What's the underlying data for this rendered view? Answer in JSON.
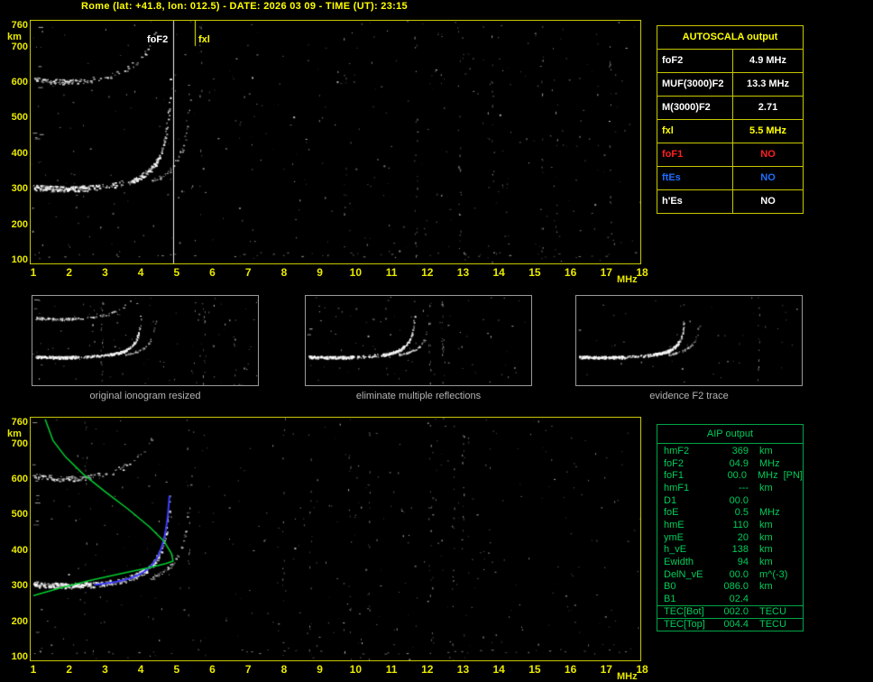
{
  "header": {
    "title": "Rome (lat: +41.8, lon: 012.5) - DATE: 2026 03 09 - TIME (UT): 23:15"
  },
  "top_plot": {
    "y_unit": "km",
    "x_unit": "MHz",
    "y_ticks": [
      760,
      700,
      600,
      500,
      400,
      300,
      200,
      100
    ],
    "x_ticks": [
      1,
      2,
      3,
      4,
      5,
      6,
      7,
      8,
      9,
      10,
      11,
      12,
      13,
      14,
      15,
      16,
      17,
      18
    ],
    "markers": [
      {
        "label": "foF2",
        "mhz": 4.9,
        "color": "#ffffff"
      },
      {
        "label": "fxl",
        "mhz": 5.5,
        "color": "#ffff00"
      }
    ]
  },
  "bottom_plot": {
    "y_unit": "km",
    "x_unit": "MHz",
    "y_ticks": [
      760,
      700,
      600,
      500,
      400,
      300,
      200,
      100
    ],
    "x_ticks": [
      1,
      2,
      3,
      4,
      5,
      6,
      7,
      8,
      9,
      10,
      11,
      12,
      13,
      14,
      15,
      16,
      17,
      18
    ]
  },
  "autoscala_table": {
    "title": "AUTOSCALA output",
    "rows": [
      {
        "label": "foF2",
        "value": "4.9 MHz",
        "color": "#ffffff"
      },
      {
        "label": "MUF(3000)F2",
        "value": "13.3 MHz",
        "color": "#ffffff"
      },
      {
        "label": "M(3000)F2",
        "value": "2.71",
        "color": "#ffffff"
      },
      {
        "label": "fxl",
        "value": "5.5 MHz",
        "color": "#ffff00"
      },
      {
        "label": "foF1",
        "value": "NO",
        "color": "#ff2020"
      },
      {
        "label": "ftEs",
        "value": "NO",
        "color": "#1e6eff"
      },
      {
        "label": "h'Es",
        "value": "NO",
        "color": "#ffffff"
      }
    ]
  },
  "thumbnails": [
    {
      "caption": "original ionogram resized"
    },
    {
      "caption": "eliminate multiple reflections"
    },
    {
      "caption": "evidence F2 trace"
    }
  ],
  "aip_table": {
    "title": "AIP output",
    "rows": [
      {
        "label": "hmF2",
        "value": "369",
        "unit": "km",
        "extra": ""
      },
      {
        "label": "foF2",
        "value": "04.9",
        "unit": "MHz",
        "extra": ""
      },
      {
        "label": "foF1",
        "value": "00.0",
        "unit": "MHz",
        "extra": "[PN]"
      },
      {
        "label": "hmF1",
        "value": "---",
        "unit": "km",
        "extra": ""
      },
      {
        "label": "D1",
        "value": "00.0",
        "unit": "",
        "extra": ""
      },
      {
        "label": "foE",
        "value": "0.5",
        "unit": "MHz",
        "extra": ""
      },
      {
        "label": "hmE",
        "value": "110",
        "unit": "km",
        "extra": ""
      },
      {
        "label": "ymE",
        "value": "20",
        "unit": "km",
        "extra": ""
      },
      {
        "label": "h_vE",
        "value": "138",
        "unit": "km",
        "extra": ""
      },
      {
        "label": "Ewidth",
        "value": "94",
        "unit": "km",
        "extra": ""
      },
      {
        "label": "DelN_vE",
        "value": "00.0",
        "unit": "m^(-3)",
        "extra": ""
      },
      {
        "label": "B0",
        "value": "086.0",
        "unit": "km",
        "extra": ""
      },
      {
        "label": "B1",
        "value": "02.4",
        "unit": "",
        "extra": ""
      }
    ],
    "tec_rows": [
      {
        "label": "TEC[Bot]",
        "value": "002.0",
        "unit": "TECU"
      },
      {
        "label": "TEC[Top]",
        "value": "004.4",
        "unit": "TECU"
      }
    ]
  },
  "colors": {
    "accent_yellow": "#ffff00",
    "plot_border": "#c8c800",
    "aip_green": "#00cc5a",
    "trace_blue": "#3b3bff",
    "profile_green": "#00d030",
    "caption_gray": "#b4b4b4"
  }
}
